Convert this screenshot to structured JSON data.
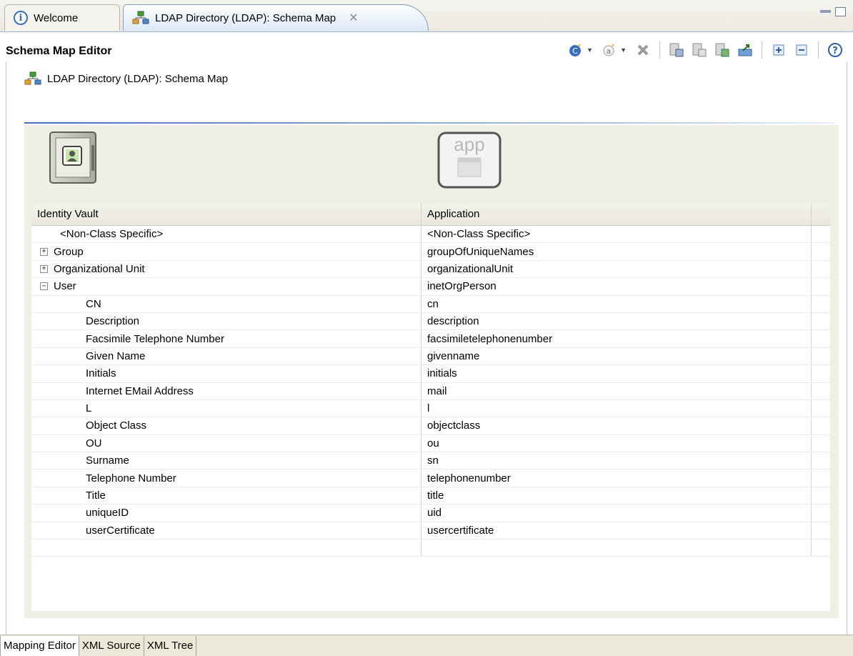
{
  "tabs": {
    "welcome": "Welcome",
    "editor": "LDAP Directory (LDAP): Schema Map"
  },
  "editor": {
    "title": "Schema Map Editor",
    "subtitle": "LDAP Directory (LDAP): Schema Map"
  },
  "toolbar": {
    "icons": [
      "add-class-mapping-icon",
      "add-attribute-mapping-icon",
      "delete-icon",
      "schema-1-icon",
      "schema-2-icon",
      "schema-3-icon",
      "export-icon",
      "expand-all-icon",
      "collapse-all-icon",
      "help-icon"
    ]
  },
  "panel": {
    "vault_header": "Identity Vault",
    "app_header": "Application",
    "app_icon_label": "app"
  },
  "rows": [
    {
      "vault": "<Non-Class Specific>",
      "app": "<Non-Class Specific>",
      "type": "nonclass"
    },
    {
      "vault": "Group",
      "app": "groupOfUniqueNames",
      "type": "collapsed"
    },
    {
      "vault": "Organizational Unit",
      "app": "organizationalUnit",
      "type": "collapsed"
    },
    {
      "vault": "User",
      "app": "inetOrgPerson",
      "type": "expanded"
    },
    {
      "vault": "CN",
      "app": "cn",
      "type": "attr"
    },
    {
      "vault": "Description",
      "app": "description",
      "type": "attr"
    },
    {
      "vault": "Facsimile Telephone Number",
      "app": "facsimiletelephonenumber",
      "type": "attr"
    },
    {
      "vault": "Given Name",
      "app": "givenname",
      "type": "attr"
    },
    {
      "vault": "Initials",
      "app": "initials",
      "type": "attr"
    },
    {
      "vault": "Internet EMail Address",
      "app": "mail",
      "type": "attr"
    },
    {
      "vault": "L",
      "app": "l",
      "type": "attr"
    },
    {
      "vault": "Object Class",
      "app": "objectclass",
      "type": "attr"
    },
    {
      "vault": "OU",
      "app": "ou",
      "type": "attr"
    },
    {
      "vault": "Surname",
      "app": "sn",
      "type": "attr"
    },
    {
      "vault": "Telephone Number",
      "app": "telephonenumber",
      "type": "attr"
    },
    {
      "vault": "Title",
      "app": "title",
      "type": "attr"
    },
    {
      "vault": "uniqueID",
      "app": "uid",
      "type": "attr"
    },
    {
      "vault": "userCertificate",
      "app": "usercertificate",
      "type": "attr"
    },
    {
      "vault": "",
      "app": "",
      "type": "empty"
    }
  ],
  "bottom_tabs": {
    "mapping": "Mapping Editor",
    "xml_source": "XML Source",
    "xml_tree": "XML Tree"
  }
}
